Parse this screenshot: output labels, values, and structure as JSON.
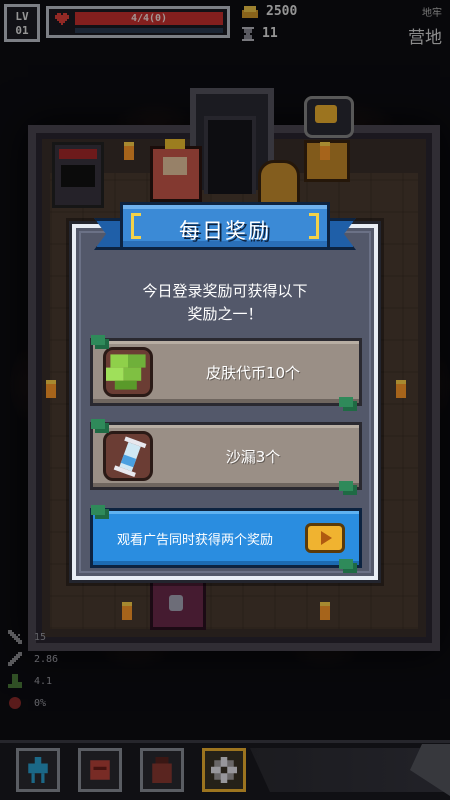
{
  "hud": {
    "level_label": "LV",
    "level_value": "01",
    "hp_text": "4/4(0)",
    "hp_fraction": 1.0,
    "gold": "2500",
    "gems": "11",
    "area_sub": "地牢",
    "area_main": "营地"
  },
  "dialog": {
    "title": "每日奖励",
    "description_line1": "今日登录奖励可获得以下",
    "description_line2": "奖励之一！",
    "rewards": [
      {
        "label": "皮肤代币10个",
        "icon": "green-coins-icon"
      },
      {
        "label": "沙漏3个",
        "icon": "hourglass-icon"
      }
    ],
    "ad_button": {
      "label": "观看广告同时获得两个奖励",
      "icon": "play-video-icon"
    }
  },
  "stats": [
    {
      "icon": "sword-icon",
      "value": "15"
    },
    {
      "icon": "dagger-icon",
      "value": "2.86"
    },
    {
      "icon": "boot-icon",
      "value": "4.1"
    },
    {
      "icon": "shield-icon",
      "value": "0%"
    }
  ],
  "nav": [
    {
      "name": "character",
      "icon": "character-icon"
    },
    {
      "name": "backpack",
      "icon": "backpack-icon"
    },
    {
      "name": "inventory",
      "icon": "bag-icon"
    },
    {
      "name": "settings",
      "icon": "gear-icon"
    }
  ],
  "colors": {
    "hp": "#c9312e",
    "banner": "#3b8ad6",
    "dialog_bg": "#53586a",
    "reward_bg": "#9a8f86",
    "ad_bg": "#2a8de0",
    "accent_gold": "#f0b330"
  }
}
